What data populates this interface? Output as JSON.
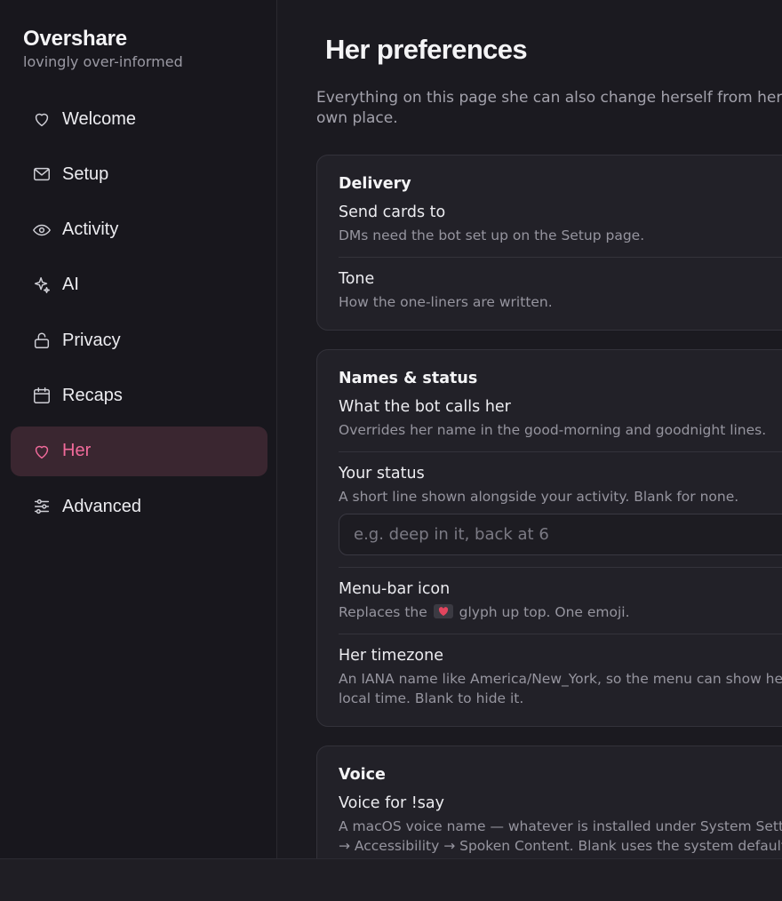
{
  "app": {
    "name": "Overshare",
    "tagline": "lovingly over-informed"
  },
  "sidebar": {
    "items": [
      {
        "label": "Welcome",
        "icon": "heart-outline-icon",
        "active": false
      },
      {
        "label": "Setup",
        "icon": "envelope-icon",
        "active": false
      },
      {
        "label": "Activity",
        "icon": "eye-icon",
        "active": false
      },
      {
        "label": "AI",
        "icon": "sparkles-icon",
        "active": false
      },
      {
        "label": "Privacy",
        "icon": "lock-icon",
        "active": false
      },
      {
        "label": "Recaps",
        "icon": "calendar-icon",
        "active": false
      },
      {
        "label": "Her",
        "icon": "heart-outline-icon",
        "active": true
      },
      {
        "label": "Advanced",
        "icon": "sliders-icon",
        "active": false
      }
    ]
  },
  "page": {
    "title": "Her preferences",
    "description": "Everything on this page she can also change herself from her own place."
  },
  "cards": {
    "delivery": {
      "title": "Delivery",
      "rows": [
        {
          "title": "Send cards to",
          "desc": "DMs need the bot set up on the Setup page."
        },
        {
          "title": "Tone",
          "desc": "How the one-liners are written."
        }
      ]
    },
    "names": {
      "title": "Names & status",
      "bot_calls": {
        "title": "What the bot calls her",
        "desc": "Overrides her name in the good-morning and goodnight lines."
      },
      "status": {
        "title": "Your status",
        "desc": "A short line shown alongside your activity. Blank for none.",
        "placeholder": "e.g. deep in it, back at 6",
        "value": ""
      },
      "menubar": {
        "title": "Menu-bar icon",
        "desc_before": "Replaces the",
        "desc_after": "glyph up top. One emoji.",
        "glyph_icon": "love-letter-emoji-icon"
      },
      "timezone": {
        "title": "Her timezone",
        "desc": "An IANA name like America/New_York, so the menu can show her local time. Blank to hide it."
      }
    },
    "voice": {
      "title": "Voice",
      "voice_say": {
        "title": "Voice for !say",
        "desc": "A macOS voice name — whatever is installed under System Settings → Accessibility → Spoken Content. Blank uses the system default."
      }
    }
  },
  "colors": {
    "accent": "#f06a9a",
    "active_bg": "#3a2630",
    "sidebar_bg": "#18171d",
    "main_bg": "#1b1a20",
    "card_bg": "#222128"
  }
}
